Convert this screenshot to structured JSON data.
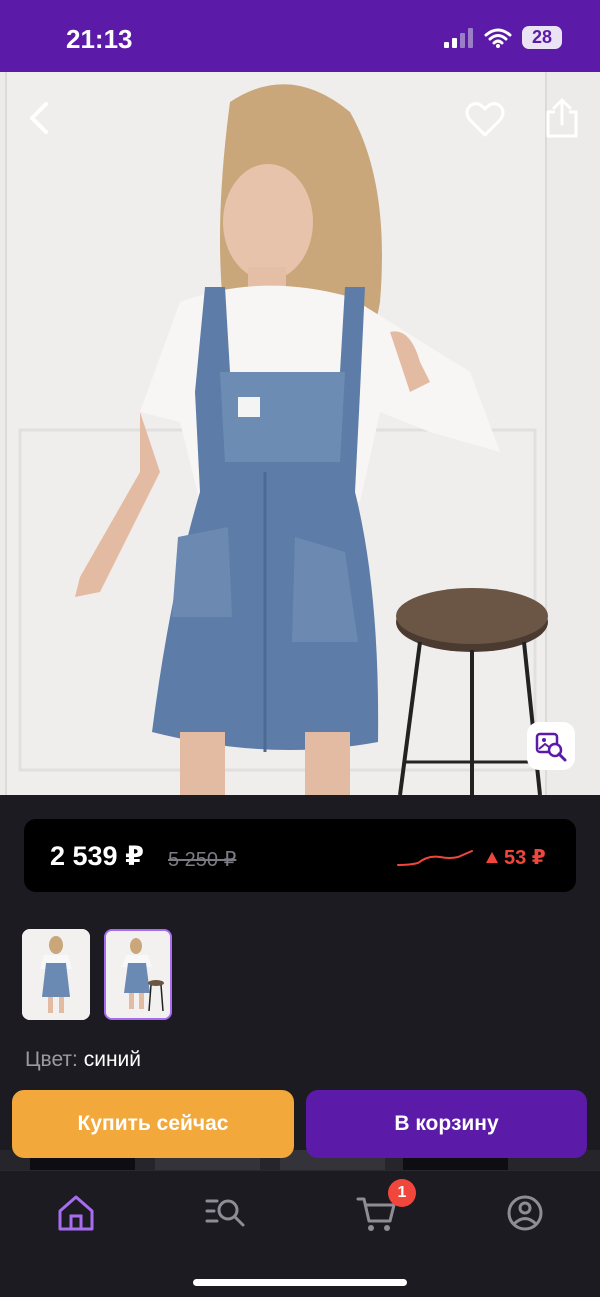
{
  "status_bar": {
    "time": "21:13",
    "battery": "28"
  },
  "product": {
    "price": "2 539 ₽",
    "old_price": "5 250 ₽",
    "price_change": "53 ₽",
    "price_change_direction": "up",
    "thumbnails_count": 2,
    "selected_thumbnail": 2
  },
  "color": {
    "label": "Цвет:",
    "value": "синий"
  },
  "actions": {
    "buy_now": "Купить сейчас",
    "add_to_cart": "В корзину"
  },
  "tabbar": {
    "cart_badge": "1",
    "active": "home"
  },
  "theme": {
    "brand": "#5b1aa8",
    "buy": "#f2a83b",
    "alert": "#f0463c",
    "active_tab": "#a76cf0"
  },
  "icons": {
    "back": "back-icon",
    "favorite": "heart-icon",
    "share": "share-icon",
    "image_search": "image-search-icon",
    "home": "home-icon",
    "catalog": "catalog-search-icon",
    "cart": "cart-icon",
    "profile": "profile-icon"
  }
}
